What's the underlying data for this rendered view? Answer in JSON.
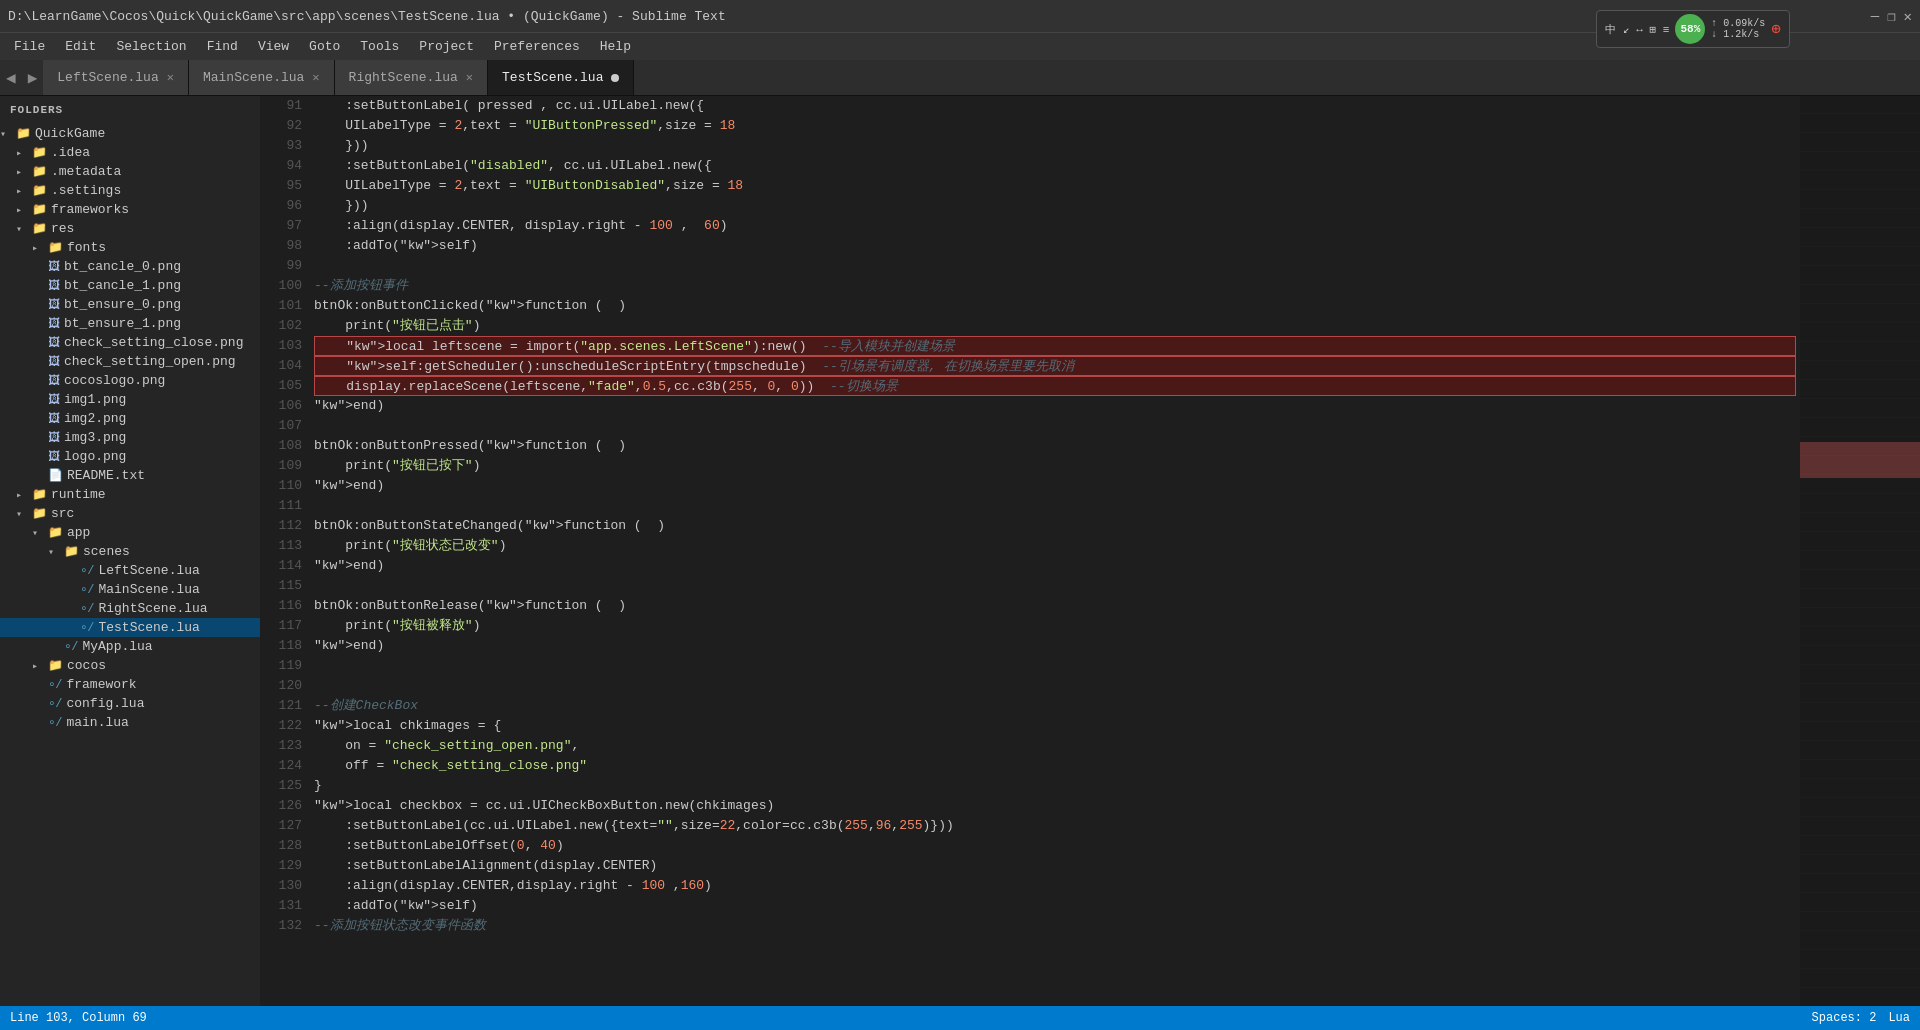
{
  "titleBar": {
    "title": "D:\\LearnGame\\Cocos\\Quick\\QuickGame\\src\\app\\scenes\\TestScene.lua • (QuickGame) - Sublime Text",
    "minimize": "—",
    "maximize": "❐",
    "close": "✕"
  },
  "menuBar": {
    "items": [
      "File",
      "Edit",
      "Selection",
      "Find",
      "View",
      "Goto",
      "Tools",
      "Project",
      "Preferences",
      "Help"
    ]
  },
  "tabs": [
    {
      "label": "LeftScene.lua",
      "active": false,
      "modified": false
    },
    {
      "label": "MainScene.lua",
      "active": false,
      "modified": false
    },
    {
      "label": "RightScene.lua",
      "active": false,
      "modified": false
    },
    {
      "label": "TestScene.lua",
      "active": true,
      "modified": true
    }
  ],
  "sidebar": {
    "header": "FOLDERS",
    "tree": [
      {
        "indent": 0,
        "type": "folder",
        "label": "QuickGame",
        "expanded": true
      },
      {
        "indent": 1,
        "type": "folder",
        "label": ".idea",
        "expanded": false
      },
      {
        "indent": 1,
        "type": "folder",
        "label": ".metadata",
        "expanded": false
      },
      {
        "indent": 1,
        "type": "folder",
        "label": ".settings",
        "expanded": false
      },
      {
        "indent": 1,
        "type": "folder",
        "label": "frameworks",
        "expanded": false
      },
      {
        "indent": 1,
        "type": "folder",
        "label": "res",
        "expanded": true
      },
      {
        "indent": 2,
        "type": "folder",
        "label": "fonts",
        "expanded": false
      },
      {
        "indent": 2,
        "type": "file-png",
        "label": "bt_cancle_0.png"
      },
      {
        "indent": 2,
        "type": "file-png",
        "label": "bt_cancle_1.png"
      },
      {
        "indent": 2,
        "type": "file-png",
        "label": "bt_ensure_0.png"
      },
      {
        "indent": 2,
        "type": "file-png",
        "label": "bt_ensure_1.png"
      },
      {
        "indent": 2,
        "type": "file-png",
        "label": "check_setting_close.png"
      },
      {
        "indent": 2,
        "type": "file-png",
        "label": "check_setting_open.png"
      },
      {
        "indent": 2,
        "type": "file-png",
        "label": "cocoslogo.png"
      },
      {
        "indent": 2,
        "type": "file-png",
        "label": "img1.png"
      },
      {
        "indent": 2,
        "type": "file-png",
        "label": "img2.png"
      },
      {
        "indent": 2,
        "type": "file-png",
        "label": "img3.png"
      },
      {
        "indent": 2,
        "type": "file-png",
        "label": "logo.png"
      },
      {
        "indent": 2,
        "type": "file-txt",
        "label": "README.txt"
      },
      {
        "indent": 1,
        "type": "folder",
        "label": "runtime",
        "expanded": false
      },
      {
        "indent": 1,
        "type": "folder",
        "label": "src",
        "expanded": true
      },
      {
        "indent": 2,
        "type": "folder",
        "label": "app",
        "expanded": true
      },
      {
        "indent": 3,
        "type": "folder",
        "label": "scenes",
        "expanded": true
      },
      {
        "indent": 4,
        "type": "file-lua",
        "label": "LeftScene.lua"
      },
      {
        "indent": 4,
        "type": "file-lua",
        "label": "MainScene.lua"
      },
      {
        "indent": 4,
        "type": "file-lua",
        "label": "RightScene.lua"
      },
      {
        "indent": 4,
        "type": "file-lua",
        "label": "TestScene.lua",
        "selected": true
      },
      {
        "indent": 3,
        "type": "file-lua",
        "label": "MyApp.lua"
      },
      {
        "indent": 2,
        "type": "folder",
        "label": "cocos",
        "expanded": false
      },
      {
        "indent": 2,
        "type": "file-lua",
        "label": "framework"
      },
      {
        "indent": 2,
        "type": "file-lua",
        "label": "config.lua"
      },
      {
        "indent": 2,
        "type": "file-lua",
        "label": "main.lua"
      }
    ]
  },
  "code": {
    "lines": [
      {
        "num": 91,
        "content": "    :setButtonLabel( pressed , cc.ui.UILabel.new({",
        "highlighted": false
      },
      {
        "num": 92,
        "content": "    UILabelType = 2,text = \"UIButtonPressed\",size = 18",
        "highlighted": false
      },
      {
        "num": 93,
        "content": "    }))",
        "highlighted": false
      },
      {
        "num": 94,
        "content": "    :setButtonLabel(\"disabled\", cc.ui.UILabel.new({",
        "highlighted": false
      },
      {
        "num": 95,
        "content": "    UILabelType = 2,text = \"UIButtonDisabled\",size = 18",
        "highlighted": false
      },
      {
        "num": 96,
        "content": "    }))",
        "highlighted": false
      },
      {
        "num": 97,
        "content": "    :align(display.CENTER, display.right - 100 ,  60)",
        "highlighted": false
      },
      {
        "num": 98,
        "content": "    :addTo(self)",
        "highlighted": false
      },
      {
        "num": 99,
        "content": "",
        "highlighted": false
      },
      {
        "num": 100,
        "content": "--添加按钮事件",
        "highlighted": false
      },
      {
        "num": 101,
        "content": "btnOk:onButtonClicked(function (  )",
        "highlighted": false
      },
      {
        "num": 102,
        "content": "    print(\"按钮已点击\")",
        "highlighted": false
      },
      {
        "num": 103,
        "content": "    local leftscene = import(\"app.scenes.LeftScene\"):new()  --导入模块并创建场景",
        "highlighted": true
      },
      {
        "num": 104,
        "content": "    self:getScheduler():unscheduleScriptEntry(tmpschedule)  --引场景有调度器, 在切换场景里要先取消",
        "highlighted": true
      },
      {
        "num": 105,
        "content": "    display.replaceScene(leftscene,\"fade\",0.5,cc.c3b(255, 0, 0))  --切换场景",
        "highlighted": true
      },
      {
        "num": 106,
        "content": "end)",
        "highlighted": false
      },
      {
        "num": 107,
        "content": "",
        "highlighted": false
      },
      {
        "num": 108,
        "content": "btnOk:onButtonPressed(function (  )",
        "highlighted": false
      },
      {
        "num": 109,
        "content": "    print(\"按钮已按下\")",
        "highlighted": false
      },
      {
        "num": 110,
        "content": "end)",
        "highlighted": false
      },
      {
        "num": 111,
        "content": "",
        "highlighted": false
      },
      {
        "num": 112,
        "content": "btnOk:onButtonStateChanged(function (  )",
        "highlighted": false
      },
      {
        "num": 113,
        "content": "    print(\"按钮状态已改变\")",
        "highlighted": false
      },
      {
        "num": 114,
        "content": "end)",
        "highlighted": false
      },
      {
        "num": 115,
        "content": "",
        "highlighted": false
      },
      {
        "num": 116,
        "content": "btnOk:onButtonRelease(function (  )",
        "highlighted": false
      },
      {
        "num": 117,
        "content": "    print(\"按钮被释放\")",
        "highlighted": false
      },
      {
        "num": 118,
        "content": "end)",
        "highlighted": false
      },
      {
        "num": 119,
        "content": "",
        "highlighted": false
      },
      {
        "num": 120,
        "content": "",
        "highlighted": false
      },
      {
        "num": 121,
        "content": "--创建CheckBox",
        "highlighted": false
      },
      {
        "num": 122,
        "content": "local chkimages = {",
        "highlighted": false
      },
      {
        "num": 123,
        "content": "    on = \"check_setting_open.png\",",
        "highlighted": false
      },
      {
        "num": 124,
        "content": "    off = \"check_setting_close.png\"",
        "highlighted": false
      },
      {
        "num": 125,
        "content": "}",
        "highlighted": false
      },
      {
        "num": 126,
        "content": "local checkbox = cc.ui.UICheckBoxButton.new(chkimages)",
        "highlighted": false
      },
      {
        "num": 127,
        "content": "    :setButtonLabel(cc.ui.UILabel.new({text=\"\",size=22,color=cc.c3b(255,96,255)}))",
        "highlighted": false
      },
      {
        "num": 128,
        "content": "    :setButtonLabelOffset(0, 40)",
        "highlighted": false
      },
      {
        "num": 129,
        "content": "    :setButtonLabelAlignment(display.CENTER)",
        "highlighted": false
      },
      {
        "num": 130,
        "content": "    :align(display.CENTER,display.right - 100 ,160)",
        "highlighted": false
      },
      {
        "num": 131,
        "content": "    :addTo(self)",
        "highlighted": false
      },
      {
        "num": 132,
        "content": "--添加按钮状态改变事件函数",
        "highlighted": false
      }
    ]
  },
  "statusBar": {
    "lineCol": "Line 103, Column 69",
    "spaces": "Spaces: 2",
    "encoding": "Lua"
  },
  "network": {
    "icons": "中 ↙ ↔ ⊞ ≡",
    "percent": "58%",
    "upload": "0.09k/s",
    "download": "1.2k/s"
  }
}
